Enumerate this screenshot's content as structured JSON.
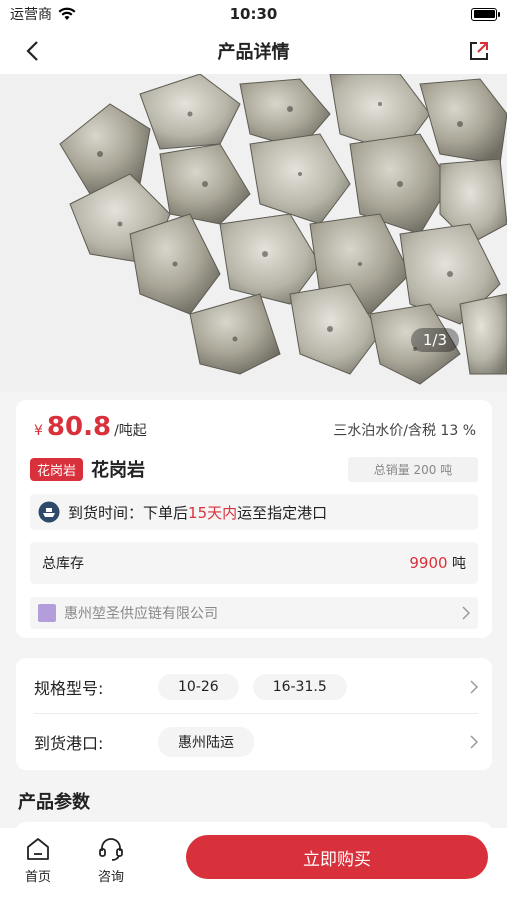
{
  "status": {
    "carrier": "运营商",
    "time": "10:30"
  },
  "nav": {
    "title": "产品详情"
  },
  "gallery": {
    "counter": "1/3"
  },
  "price": {
    "symbol": "¥",
    "amount": "80.8",
    "unit": "/吨起",
    "tax_note": "三水泊水价/含税 13 %"
  },
  "product": {
    "category_tag": "花岗岩",
    "name": "花岗岩",
    "sales": "总销量 200 吨"
  },
  "delivery": {
    "label": "到货时间：",
    "prefix": "下单后",
    "days": "15天内",
    "suffix": "运至指定港口"
  },
  "stock": {
    "label": "总库存",
    "value": "9900",
    "unit": "吨"
  },
  "supplier": {
    "name": "惠州堃圣供应链有限公司"
  },
  "spec": {
    "label": "规格型号:",
    "options": [
      "10-26",
      "16-31.5"
    ]
  },
  "port": {
    "label": "到货港口:",
    "value": "惠州陆运"
  },
  "params": {
    "title": "产品参数"
  },
  "bottom": {
    "home": "首页",
    "consult": "咨询",
    "buy": "立即购买"
  },
  "colors": {
    "accent": "#d9313c"
  },
  "icons": [
    "back-icon",
    "share-icon",
    "wifi-icon",
    "battery-icon",
    "ship-icon",
    "chevron-right-icon",
    "home-icon",
    "headset-icon"
  ]
}
